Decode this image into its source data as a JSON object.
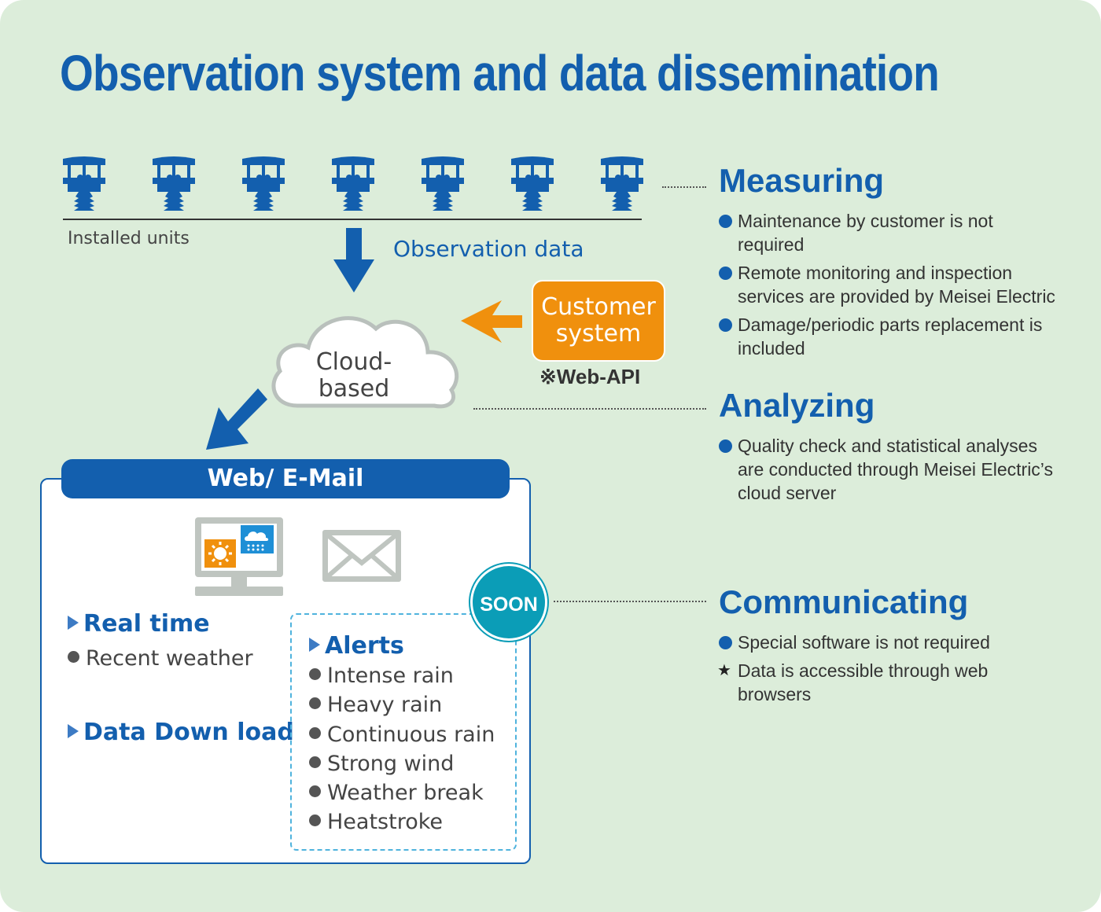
{
  "title": "Observation system and data dissemination",
  "installed_units": {
    "label": "Installed units",
    "count": 7,
    "icon": "weather-station-icon"
  },
  "flow": {
    "observation_data_label": "Observation data",
    "cloud_label_line1": "Cloud-",
    "cloud_label_line2": "based",
    "customer_system_line1": "Customer",
    "customer_system_line2": "system",
    "web_api_label": "※Web-API"
  },
  "panel": {
    "header": "Web∕ E-Mail",
    "icons": [
      "monitor-weather-icon",
      "envelope-icon"
    ],
    "soon_badge": "SOON",
    "realtime": {
      "heading": "Real time",
      "items": [
        "Recent weather"
      ]
    },
    "download": {
      "heading": "Data Down load"
    },
    "alerts": {
      "heading": "Alerts",
      "items": [
        "Intense rain",
        "Heavy rain",
        "Continuous rain",
        "Strong wind",
        "Weather break",
        "Heatstroke"
      ]
    }
  },
  "sections": {
    "measuring": {
      "title": "Measuring",
      "bullets": [
        {
          "marker": "dot",
          "lines": [
            "Maintenance by customer is not",
            "required"
          ]
        },
        {
          "marker": "dot",
          "lines": [
            "Remote monitoring and inspection",
            "services are provided by Meisei Electric"
          ]
        },
        {
          "marker": "dot",
          "lines": [
            "Damage/periodic parts replacement is",
            "included"
          ]
        }
      ]
    },
    "analyzing": {
      "title": "Analyzing",
      "bullets": [
        {
          "marker": "dot",
          "lines": [
            "Quality check and statistical analyses",
            "are conducted through Meisei Electric’s",
            "cloud server"
          ]
        }
      ]
    },
    "communicating": {
      "title": "Communicating",
      "bullets": [
        {
          "marker": "dot",
          "lines": [
            "Special software is not required"
          ]
        },
        {
          "marker": "star",
          "lines": [
            "Data is accessible through web",
            "browsers"
          ]
        }
      ]
    }
  },
  "colors": {
    "background": "#dcedda",
    "primary_blue": "#135fae",
    "orange": "#f0900d",
    "teal": "#0b9db7",
    "gray_icon": "#bfc5c0"
  }
}
